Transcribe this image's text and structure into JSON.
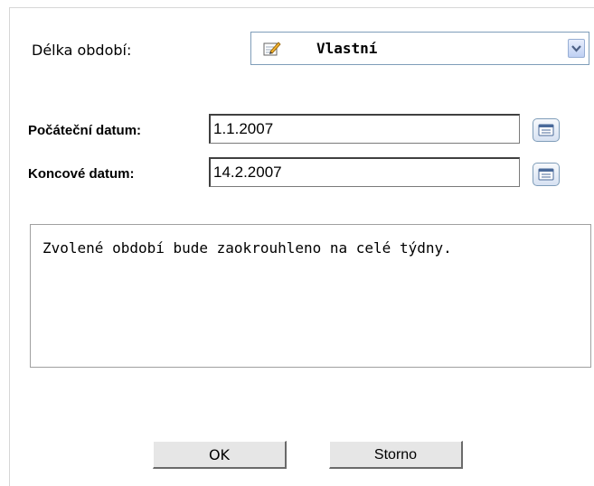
{
  "period": {
    "label": "Délka období:",
    "selected": "Vlastní",
    "icon": "edit-note-icon"
  },
  "start_date": {
    "label": "Počáteční datum:",
    "value": "1.1.2007"
  },
  "end_date": {
    "label": "Koncové datum:",
    "value": "14.2.2007"
  },
  "info": {
    "text": "Zvolené období bude zaokrouhleno na celé týdny."
  },
  "buttons": {
    "ok": "OK",
    "cancel": "Storno"
  }
}
